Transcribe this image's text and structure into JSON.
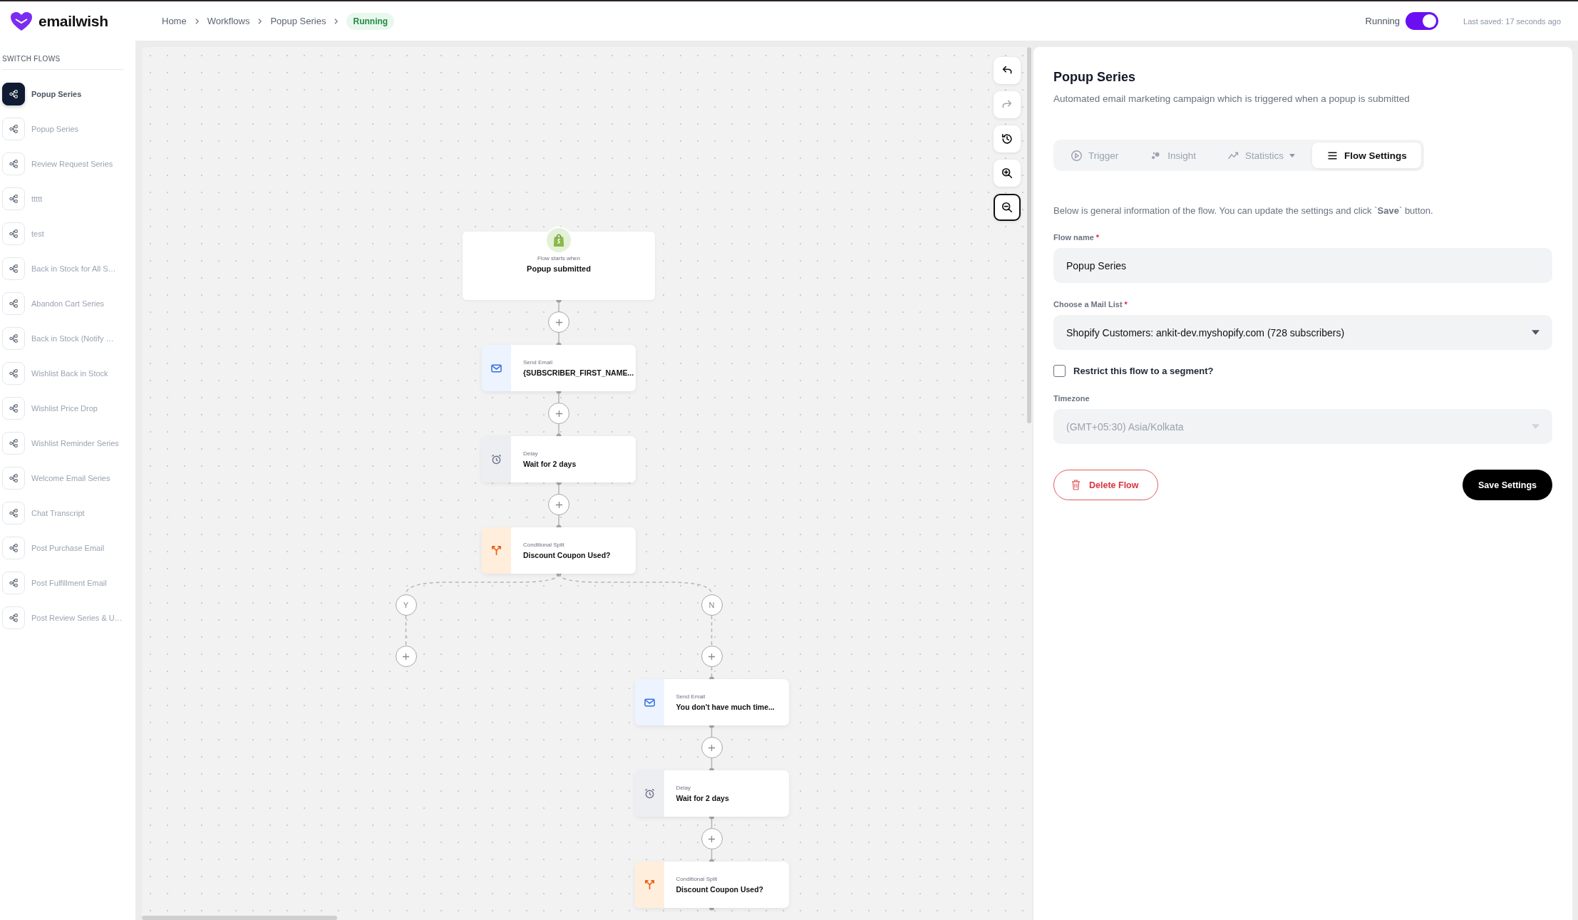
{
  "header": {
    "logo": "emailwish",
    "breadcrumbs": [
      {
        "label": "Home"
      },
      {
        "label": "Workflows"
      },
      {
        "label": "Popup Series"
      }
    ],
    "status_badge": "Running",
    "toggle": {
      "label": "Running",
      "on": true
    },
    "last_saved": "Last saved: 17 seconds ago"
  },
  "sidebar": {
    "title": "SWITCH FLOWS",
    "items": [
      {
        "label": "Popup Series",
        "selected": true
      },
      {
        "label": "Popup Series",
        "selected": false
      },
      {
        "label": "Review Request Series",
        "selected": false
      },
      {
        "label": "ttttt",
        "selected": false
      },
      {
        "label": "test",
        "selected": false
      },
      {
        "label": "Back in Stock for All S…",
        "selected": false
      },
      {
        "label": "Abandon Cart Series",
        "selected": false
      },
      {
        "label": "Back in Stock (Notify …",
        "selected": false
      },
      {
        "label": "Wishlist Back in Stock",
        "selected": false
      },
      {
        "label": "Wishlist Price Drop",
        "selected": false
      },
      {
        "label": "Wishlist Reminder Series",
        "selected": false
      },
      {
        "label": "Welcome Email Series",
        "selected": false
      },
      {
        "label": "Chat Transcript",
        "selected": false
      },
      {
        "label": "Post Purchase Email",
        "selected": false
      },
      {
        "label": "Post Fulfillment Email",
        "selected": false
      },
      {
        "label": "Post Review Series & U…",
        "selected": false
      }
    ]
  },
  "canvas": {
    "controls": [
      {
        "kind": "undo",
        "disabled": false,
        "selected": false
      },
      {
        "kind": "redo",
        "disabled": true,
        "selected": false
      },
      {
        "kind": "history",
        "disabled": false,
        "selected": false
      },
      {
        "kind": "zoom_in",
        "disabled": false,
        "selected": false
      },
      {
        "kind": "zoom_out",
        "disabled": false,
        "selected": true
      }
    ],
    "flow": {
      "trigger": {
        "caption": "Flow starts when",
        "title": "Popup submitted"
      },
      "steps": [
        {
          "kind": "email",
          "caption": "Send Email",
          "title": "{SUBSCRIBER_FIRST_NAME..."
        },
        {
          "kind": "delay",
          "caption": "Delay",
          "title": "Wait for 2 days"
        },
        {
          "kind": "split",
          "caption": "Conditional Split",
          "title": "Discount Coupon Used?",
          "branches": [
            {
              "label": "Y"
            },
            {
              "label": "N",
              "steps": [
                {
                  "kind": "email",
                  "caption": "Send Email",
                  "title": "You don't have much time..."
                },
                {
                  "kind": "delay",
                  "caption": "Delay",
                  "title": "Wait for 2 days"
                },
                {
                  "kind": "split",
                  "caption": "Conditional Split",
                  "title": "Discount Coupon Used?"
                }
              ]
            }
          ]
        }
      ]
    }
  },
  "panel": {
    "title": "Popup Series",
    "description": "Automated email marketing campaign which is triggered when a popup is submitted",
    "tabs": [
      {
        "kind": "trigger",
        "label": "Trigger",
        "selected": false,
        "menu": false
      },
      {
        "kind": "insight",
        "label": "Insight",
        "selected": false,
        "menu": false
      },
      {
        "kind": "statistics",
        "label": "Statistics",
        "selected": false,
        "menu": true
      },
      {
        "kind": "settings",
        "label": "Flow Settings",
        "selected": true,
        "menu": false
      }
    ],
    "intro": "Below is general information of the flow. You can update the settings and click `**Save**` button.",
    "flow_name": {
      "label": "Flow name",
      "required_mark": "*",
      "value": "Popup Series"
    },
    "mail_list": {
      "label": "Choose a Mail List",
      "required_mark": "*",
      "value": "Shopify Customers: ankit-dev.myshopify.com (728 subscribers)"
    },
    "restrict": {
      "label": "Restrict this flow to a segment?",
      "checked": false
    },
    "timezone": {
      "label": "Timezone",
      "value": "(GMT+05:30) Asia/Kolkata",
      "disabled": true
    },
    "delete_button": "Delete Flow",
    "save_button": "Save Settings"
  }
}
